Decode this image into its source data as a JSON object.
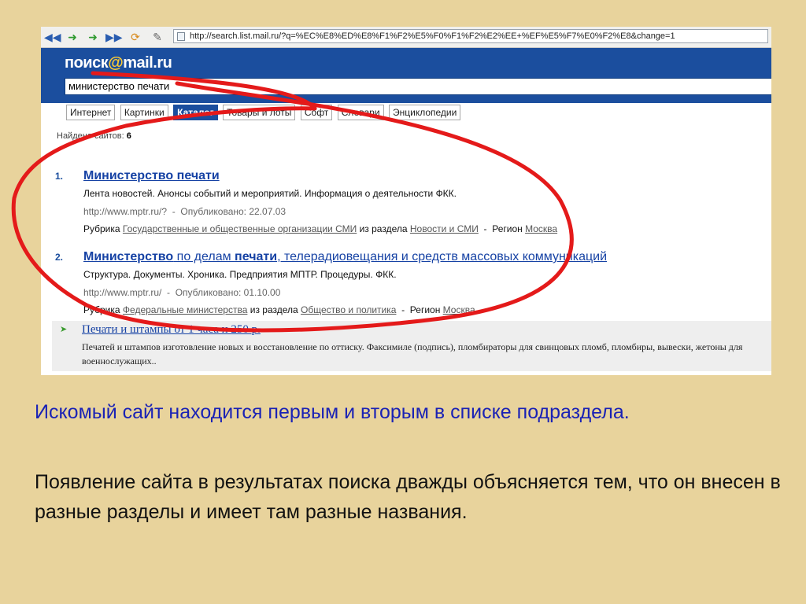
{
  "browser": {
    "address": "http://search.list.mail.ru/?q=%EC%E8%ED%E8%F1%F2%E5%F0%F1%F2%E2%EE+%EF%E5%F7%E0%F2%E8&change=1"
  },
  "header": {
    "logo_left": "поиск",
    "logo_at": "@",
    "logo_right": "mail.ru",
    "query": "министерство печати"
  },
  "tabs": [
    {
      "label": "Интернет",
      "active": false
    },
    {
      "label": "Картинки",
      "active": false
    },
    {
      "label": "Каталог",
      "active": true
    },
    {
      "label": "Товары и лоты",
      "active": false
    },
    {
      "label": "Софт",
      "active": false
    },
    {
      "label": "Словари",
      "active": false
    },
    {
      "label": "Энциклопедии",
      "active": false
    }
  ],
  "found": {
    "label": "Найдено сайтов:",
    "count": "6"
  },
  "results": [
    {
      "num": "1.",
      "title": "Министерство печати",
      "desc": "Лента новостей. Анонсы событий и мероприятий. Информация о деятельности ФКК.",
      "url": "http://www.mptr.ru/?",
      "published": "Опубликовано: 22.07.03",
      "rubric_label": "Рубрика",
      "rubric": "Государственные и общественные организации СМИ",
      "section_label": "из раздела",
      "section": "Новости и СМИ",
      "region_label": "Регион",
      "region": "Москва"
    },
    {
      "num": "2.",
      "title_a": "Министерство",
      "title_b": " по делам ",
      "title_c": "печати",
      "title_d": ", телерадиовещания и средств массовых коммуникаций",
      "desc": "Структура. Документы. Хроника. Предприятия МПТР. Процедуры. ФКК.",
      "url": "http://www.mptr.ru/",
      "published": "Опубликовано: 01.10.00",
      "rubric_label": "Рубрика",
      "rubric": "Федеральные министерства",
      "section_label": "из раздела",
      "section": "Общество и политика",
      "region_label": "Регион",
      "region": "Москва"
    }
  ],
  "ad": {
    "title": "Печати и штампы от 1 часа и 250 р.",
    "text": "Печатей и штампов изготовление новых и восстановление по оттиску. Факсимиле (подпись), пломбираторы для свинцовых пломб, пломбиры, вывески, жетоны для военнослужащих.."
  },
  "caption": {
    "line1": "Искомый сайт находится первым и вторым в списке подраздела.",
    "line2": "Появление сайта в результатах поиска дважды объясняется тем, что он внесен в разные разделы и имеет там разные названия."
  },
  "colors": {
    "background": "#e8d39c",
    "header_blue": "#1b4e9e",
    "annotation_red": "#e41a1a",
    "caption_blue": "#1a22b5"
  }
}
